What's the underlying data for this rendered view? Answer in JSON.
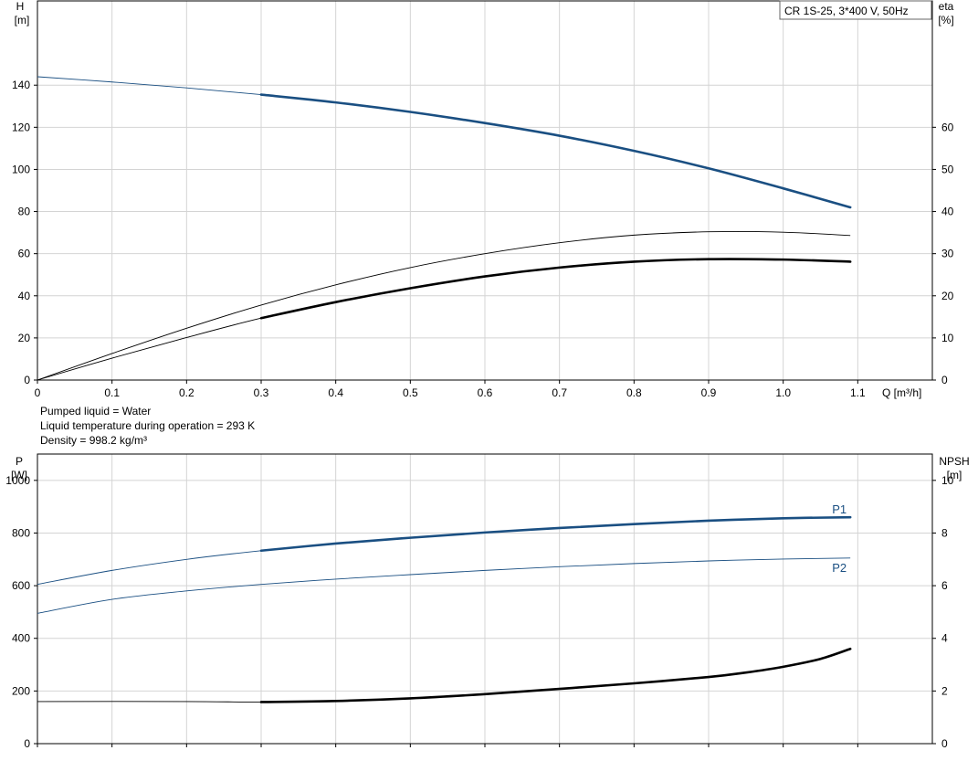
{
  "chart_data": [
    {
      "type": "line",
      "title": "",
      "legend_box": "CR 1S-25, 3*400 V, 50Hz",
      "x_axis": {
        "label": "Q [m³/h]",
        "range": [
          0,
          1.2
        ],
        "ticks": [
          0,
          0.1,
          0.2,
          0.3,
          0.4,
          0.5,
          0.6,
          0.7,
          0.8,
          0.9,
          1.0,
          1.1
        ],
        "tick_labels": [
          "0",
          "0.1",
          "0.2",
          "0.3",
          "0.4",
          "0.5",
          "0.6",
          "0.7",
          "0.8",
          "0.9",
          "1.0",
          "1.1"
        ]
      },
      "y_left": {
        "label_line1": "H",
        "label_line2": "[m]",
        "range": [
          0,
          180
        ],
        "ticks": [
          0,
          20,
          40,
          60,
          80,
          100,
          120,
          140
        ],
        "tick_labels": [
          "0",
          "20",
          "40",
          "60",
          "80",
          "100",
          "120",
          "140"
        ]
      },
      "y_right": {
        "label_line1": "eta",
        "label_line2": "[%]",
        "range": [
          0,
          90
        ],
        "ticks": [
          0,
          10,
          20,
          30,
          40,
          50,
          60
        ],
        "tick_labels": [
          "0",
          "10",
          "20",
          "30",
          "40",
          "50",
          "60"
        ]
      },
      "grid": true,
      "series": [
        {
          "axis": "left",
          "color": "#1a4f82",
          "x": [
            0,
            0.1,
            0.2,
            0.3,
            0.4,
            0.5,
            0.6,
            0.7,
            0.8,
            0.9,
            1.0,
            1.09
          ],
          "y": [
            144,
            141.5,
            138.7,
            135.5,
            131.8,
            127.3,
            122,
            116,
            108.8,
            100.5,
            91,
            82
          ],
          "operating_range": [
            0.3,
            1.09
          ]
        },
        {
          "axis": "right",
          "color": "#000000",
          "x": [
            0,
            0.1,
            0.2,
            0.3,
            0.4,
            0.5,
            0.6,
            0.7,
            0.8,
            0.9,
            1.0,
            1.09
          ],
          "y": [
            0,
            6.3,
            12.3,
            17.8,
            22.6,
            26.7,
            30,
            32.6,
            34.4,
            35.2,
            35.1,
            34.3
          ],
          "operating_range": null
        },
        {
          "axis": "right",
          "color": "#000000",
          "x": [
            0,
            0.1,
            0.2,
            0.3,
            0.4,
            0.5,
            0.6,
            0.7,
            0.8,
            0.9,
            1.0,
            1.09
          ],
          "y": [
            0,
            5.2,
            10.1,
            14.7,
            18.5,
            21.8,
            24.6,
            26.7,
            28.1,
            28.7,
            28.6,
            28.1
          ],
          "operating_range": [
            0.3,
            1.09
          ]
        }
      ]
    },
    {
      "type": "line",
      "title": "",
      "x_axis": {
        "range": [
          0,
          1.2
        ],
        "ticks": [
          0,
          0.1,
          0.2,
          0.3,
          0.4,
          0.5,
          0.6,
          0.7,
          0.8,
          0.9,
          1.0,
          1.1
        ]
      },
      "y_left": {
        "label_line1": "P",
        "label_line2": "[W]",
        "range": [
          0,
          1100
        ],
        "ticks": [
          0,
          200,
          400,
          600,
          800,
          1000
        ],
        "tick_labels": [
          "0",
          "200",
          "400",
          "600",
          "800",
          "1000"
        ]
      },
      "y_right": {
        "label_line1": "NPSH",
        "label_line2": "[m]",
        "range": [
          0,
          11
        ],
        "ticks": [
          0,
          2,
          4,
          6,
          8,
          10
        ],
        "tick_labels": [
          "0",
          "2",
          "4",
          "6",
          "8",
          "10"
        ]
      },
      "grid": true,
      "series": [
        {
          "name": "P1",
          "axis": "left",
          "color": "#1a4f82",
          "x": [
            0,
            0.1,
            0.2,
            0.3,
            0.4,
            0.5,
            0.6,
            0.7,
            0.8,
            0.9,
            1.0,
            1.09
          ],
          "y": [
            605,
            658,
            700,
            733,
            760,
            782,
            802,
            819,
            834,
            847,
            856,
            860
          ],
          "operating_range": [
            0.3,
            1.09
          ]
        },
        {
          "name": "P2",
          "axis": "left",
          "color": "#1a4f82",
          "x": [
            0,
            0.1,
            0.2,
            0.3,
            0.4,
            0.5,
            0.6,
            0.7,
            0.8,
            0.9,
            1.0,
            1.09
          ],
          "y": [
            495,
            548,
            580,
            605,
            625,
            642,
            658,
            672,
            684,
            694,
            701,
            705
          ],
          "operating_range": null
        },
        {
          "axis": "right",
          "color": "#000000",
          "x": [
            0,
            0.2,
            0.3,
            0.4,
            0.5,
            0.6,
            0.7,
            0.8,
            0.9,
            0.95,
            1.0,
            1.05,
            1.09
          ],
          "y": [
            1.6,
            1.6,
            1.58,
            1.62,
            1.72,
            1.88,
            2.08,
            2.29,
            2.53,
            2.7,
            2.92,
            3.22,
            3.6
          ],
          "operating_range": [
            0.3,
            1.09
          ]
        }
      ]
    }
  ],
  "info": {
    "line1": "Pumped liquid = Water",
    "line2": "Liquid temperature during operation = 293 K",
    "line3": "Density = 998.2 kg/m³"
  }
}
